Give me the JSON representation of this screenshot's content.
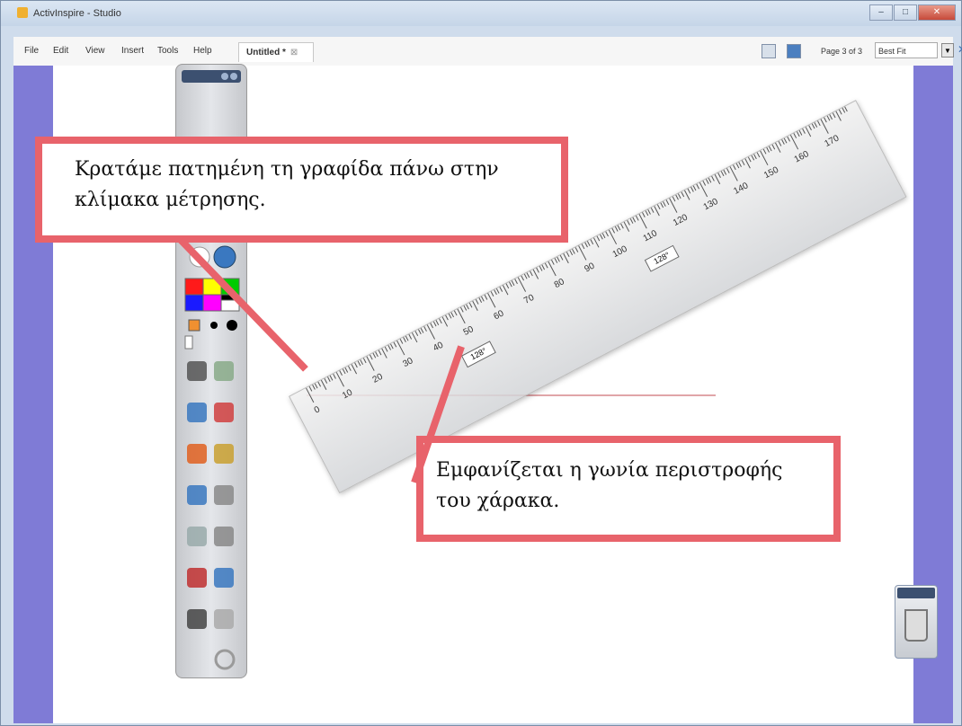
{
  "window": {
    "title": "ActivInspire - Studio",
    "controls": [
      "–",
      "□",
      "✕"
    ]
  },
  "menu": {
    "items": [
      "File",
      "Edit",
      "View",
      "Insert",
      "Tools",
      "Help"
    ]
  },
  "doc_tab": {
    "label": "Untitled *",
    "close": "⊠"
  },
  "pager": {
    "label": "Page 3 of 3",
    "zoom": "Best Fit"
  },
  "ruler": {
    "labels": [
      "0",
      "10",
      "20",
      "30",
      "40",
      "50",
      "60",
      "70",
      "80",
      "90",
      "100",
      "110",
      "120",
      "130",
      "140",
      "150",
      "160",
      "170"
    ],
    "angle": "128°"
  },
  "callouts": {
    "first": [
      "Κρατάμε πατημένη τη γραφίδα πάνω στην",
      "κλίμακα μέτρησης."
    ],
    "second": [
      "Εμφανίζεται η γωνία περιστροφής",
      "του χάρακα."
    ]
  },
  "colors": {
    "callout_border": "#e8636b",
    "sidebar": "#7f7bd6"
  },
  "toolbox": {
    "colors": [
      "#ff1a1a",
      "#ffff00",
      "#00cc00",
      "#1a1aff",
      "#ff00ff",
      "#000000",
      "#ffffff"
    ],
    "tools": [
      "select-icon",
      "pen-icon",
      "highlighter-icon",
      "eraser-icon",
      "fill-icon",
      "shape-icon",
      "connector-icon",
      "ruler-tool-icon",
      "protractor-icon",
      "calculator-icon",
      "dice-icon",
      "spotlight-icon",
      "undo-icon",
      "redo-icon"
    ]
  }
}
